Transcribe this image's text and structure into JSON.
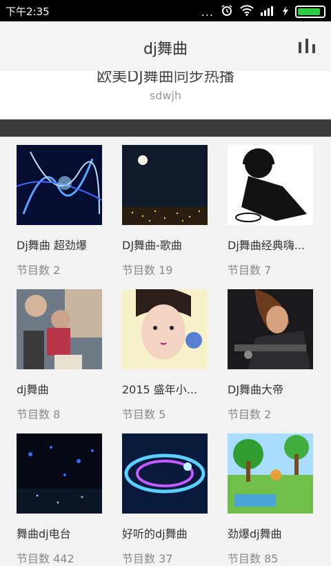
{
  "status": {
    "time": "下午2:35",
    "dots": "...",
    "battery_level": 0.9
  },
  "appbar": {
    "title": "dj舞曲"
  },
  "header": {
    "headline": "欧美DJ舞曲同步热播",
    "sub": "sdwjh"
  },
  "items": [
    {
      "name": "Dj舞曲   超劲爆",
      "count": "节目数 2"
    },
    {
      "name": "DJ舞曲-歌曲",
      "count": "节目数 19"
    },
    {
      "name": "Dj舞曲经典嗨...",
      "count": "节目数 7"
    },
    {
      "name": "dj舞曲",
      "count": "节目数 8"
    },
    {
      "name": "2015 盛年小...",
      "count": "节目数 5"
    },
    {
      "name": "DJ舞曲大帝",
      "count": "节目数 2"
    },
    {
      "name": "舞曲dj电台",
      "count": "节目数 442"
    },
    {
      "name": "好听的dj舞曲",
      "count": "节目数 37"
    },
    {
      "name": "劲爆dj舞曲",
      "count": "节目数 85"
    }
  ],
  "icons": {
    "signal": "wifi-icon",
    "cell": "cellular-signal-icon",
    "alarm": "alarm-icon",
    "battery": "battery-icon",
    "menu": "equalizer-icon"
  }
}
